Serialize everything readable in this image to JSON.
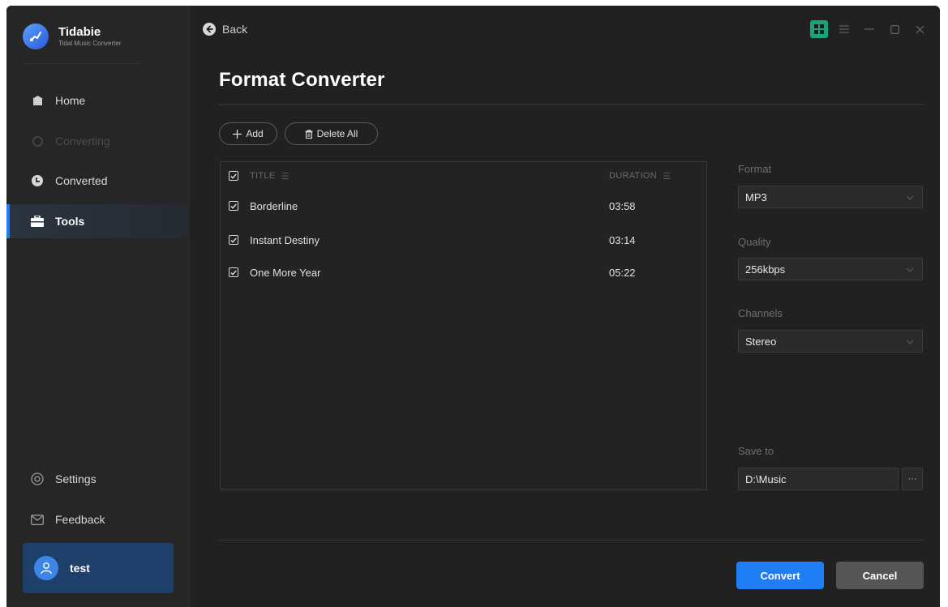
{
  "app": {
    "name": "Tidabie",
    "subtitle": "Tidal Music Converter"
  },
  "sidebar": {
    "items": [
      {
        "label": "Home",
        "icon": "home-icon",
        "state": "normal"
      },
      {
        "label": "Converting",
        "icon": "converting-icon",
        "state": "disabled"
      },
      {
        "label": "Converted",
        "icon": "clock-icon",
        "state": "normal"
      },
      {
        "label": "Tools",
        "icon": "toolbox-icon",
        "state": "active"
      }
    ],
    "bottom": [
      {
        "label": "Settings",
        "icon": "gear-icon"
      },
      {
        "label": "Feedback",
        "icon": "mail-icon"
      }
    ],
    "user": {
      "name": "test",
      "icon": "user-icon"
    }
  },
  "topbar": {
    "back_label": "Back"
  },
  "page": {
    "title": "Format Converter",
    "add_label": "Add",
    "delete_all_label": "Delete All"
  },
  "table": {
    "columns": {
      "title": "TITLE",
      "duration": "DURATION"
    },
    "rows": [
      {
        "title": "Borderline",
        "duration": "03:58",
        "checked": true
      },
      {
        "title": "Instant Destiny",
        "duration": "03:14",
        "checked": true
      },
      {
        "title": "One More Year",
        "duration": "05:22",
        "checked": true
      }
    ]
  },
  "settings": {
    "format": {
      "label": "Format",
      "value": "MP3"
    },
    "quality": {
      "label": "Quality",
      "value": "256kbps"
    },
    "channels": {
      "label": "Channels",
      "value": "Stereo"
    },
    "save_to": {
      "label": "Save to",
      "value": "D:\\Music",
      "browse_label": "···"
    }
  },
  "actions": {
    "convert_label": "Convert",
    "cancel_label": "Cancel"
  },
  "colors": {
    "accent": "#1f7ef5",
    "background": "#212121",
    "sidebar": "#262626",
    "cancel": "#555555",
    "view_toggle": "#1aa37a"
  }
}
